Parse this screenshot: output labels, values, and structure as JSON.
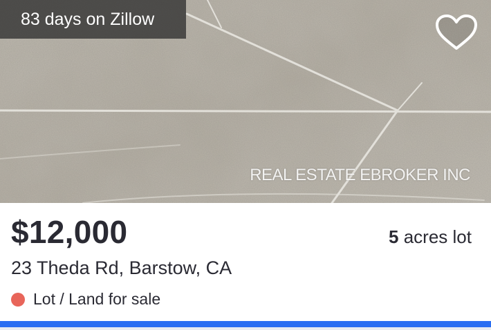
{
  "listing": {
    "days_on_site": "83 days on Zillow",
    "favorite_icon": "heart-outline-icon",
    "watermark": "REAL ESTATE EBROKER INC",
    "price": "$12,000",
    "lot_size_value": "5",
    "lot_size_unit": " acres lot",
    "address": "23 Theda Rd, Barstow, CA",
    "status": "Lot / Land for sale"
  },
  "colors": {
    "status_dot": "#e8655a",
    "accent_bar": "#2a6ef2",
    "text": "#2a2a33"
  }
}
